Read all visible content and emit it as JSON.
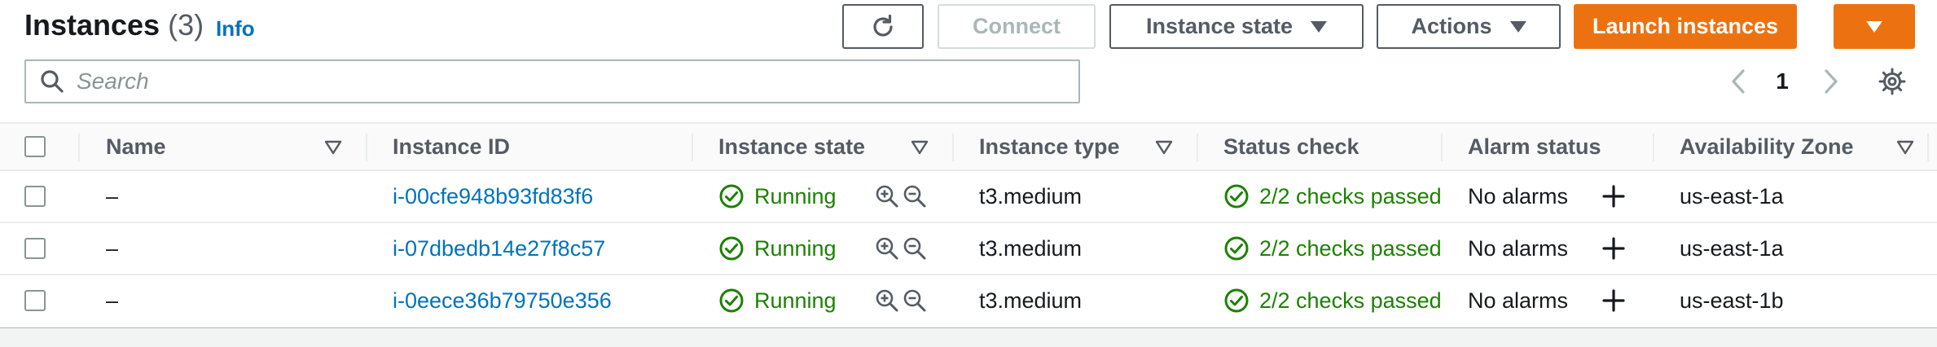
{
  "header": {
    "title": "Instances",
    "count": "(3)",
    "info_link": "Info"
  },
  "toolbar": {
    "refresh_icon": "refresh-icon",
    "connect_label": "Connect",
    "instance_state_label": "Instance state",
    "actions_label": "Actions",
    "launch_label": "Launch instances",
    "launch_dropdown_icon": "caret-down-icon"
  },
  "search": {
    "placeholder": "Search",
    "value": ""
  },
  "pagination": {
    "current_page": "1"
  },
  "table": {
    "columns": [
      "Name",
      "Instance ID",
      "Instance state",
      "Instance type",
      "Status check",
      "Alarm status",
      "Availability Zone"
    ],
    "rows": [
      {
        "name": "–",
        "instance_id": "i-00cfe948b93fd83f6",
        "state": "Running",
        "type": "t3.medium",
        "status_check": "2/2 checks passed",
        "alarm": "No alarms",
        "zone": "us-east-1a"
      },
      {
        "name": "–",
        "instance_id": "i-07dbedb14e27f8c57",
        "state": "Running",
        "type": "t3.medium",
        "status_check": "2/2 checks passed",
        "alarm": "No alarms",
        "zone": "us-east-1a"
      },
      {
        "name": "–",
        "instance_id": "i-0eece36b79750e356",
        "state": "Running",
        "type": "t3.medium",
        "status_check": "2/2 checks passed",
        "alarm": "No alarms",
        "zone": "us-east-1b"
      }
    ]
  },
  "colors": {
    "primary": "#ec7211",
    "link": "#0073bb",
    "success": "#1d8102",
    "text": "#16191f",
    "muted": "#545b64"
  }
}
